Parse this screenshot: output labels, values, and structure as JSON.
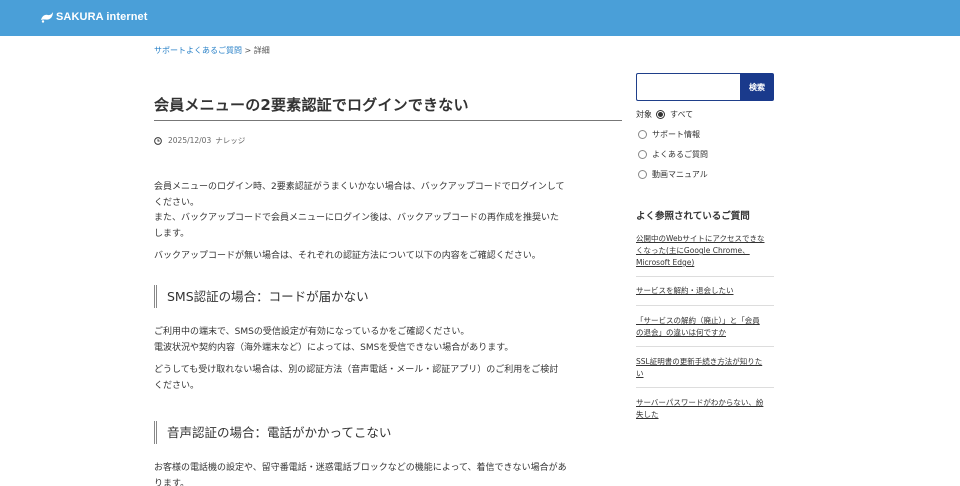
{
  "header": {
    "logo_text": "SAKURA internet",
    "color": "#4a9fd8"
  },
  "breadcrumb": {
    "link_label": "サポートよくあるご質問",
    "separator": " > ",
    "current": "詳細"
  },
  "article": {
    "title": "会員メニューの2要素認証でログインできない",
    "date": "2025/12/03",
    "tag": "ナレッジ",
    "intro_lines": [
      "会員メニューのログイン時、2要素認証がうまくいかない場合は、バックアップコードでログインして",
      "ください。",
      "また、バックアップコードで会員メニューにログイン後は、バックアップコードの再作成を推奨いた",
      "します。"
    ],
    "intro2": "バックアップコードが無い場合は、それぞれの認証方法について以下の内容をご確認ください。",
    "sms_heading": "SMS認証の場合：コードが届かない",
    "sms_lines": [
      "ご利用中の端末で、SMSの受信設定が有効になっているかをご確認ください。",
      "電波状況や契約内容（海外端末など）によっては、SMSを受信できない場合があります。"
    ],
    "sms2_lines": [
      "どうしても受け取れない場合は、別の認証方法（音声電話・メール・認証アプリ）のご利用をご検討",
      "ください。"
    ],
    "voice_heading": "音声認証の場合：電話がかかってこない",
    "voice_lines": [
      "お客様の電話機の設定や、留守番電話・迷惑電話ブロックなどの機能によって、着信できない場合があ",
      "ります。"
    ]
  },
  "sidebar": {
    "search": {
      "placeholder": "",
      "button_label": "検索"
    },
    "filter": {
      "label": "対象",
      "options": [
        "すべて",
        "サポート情報",
        "よくあるご質問",
        "動画マニュアル"
      ],
      "selected": "すべて"
    },
    "popular_title": "よく参照されているご質問",
    "popular_links": [
      [
        "公開中のWebサイトにアクセスできな",
        "くなった(主にGoogle Chrome、",
        "Microsoft Edge)"
      ],
      [
        "サービスを解約・退会したい"
      ],
      [
        "「サービスの解約（廃止）」と「会員",
        "の退会」の違いは何ですか"
      ],
      [
        "SSL証明書の更新手続き方法が知りた",
        "い"
      ],
      [
        "サーバーパスワードがわからない、紛",
        "失した"
      ]
    ]
  }
}
